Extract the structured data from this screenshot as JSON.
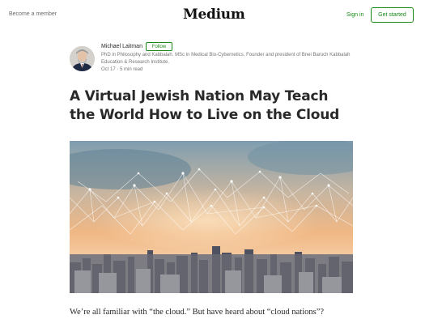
{
  "header": {
    "become_member": "Become a member",
    "logo": "Medium",
    "sign_in": "Sign in",
    "get_started": "Get started"
  },
  "author": {
    "name": "Michael Laitman",
    "follow": "Follow",
    "bio": "PhD in Philosophy and Kabbalah. MSc in Medical Bio-Cybernetics. Founder and president of Bnei Baruch Kabbalah Education & Research Institute.",
    "meta": "Oct 17 · 5 min read"
  },
  "article": {
    "title": "A Virtual Jewish Nation May Teach the World How to Live on the Cloud",
    "lead": "We’re all familiar with “the cloud.” But have heard about “cloud nations”?"
  },
  "colors": {
    "accent": "#1a8917",
    "text": "#292929",
    "muted": "#757575"
  }
}
